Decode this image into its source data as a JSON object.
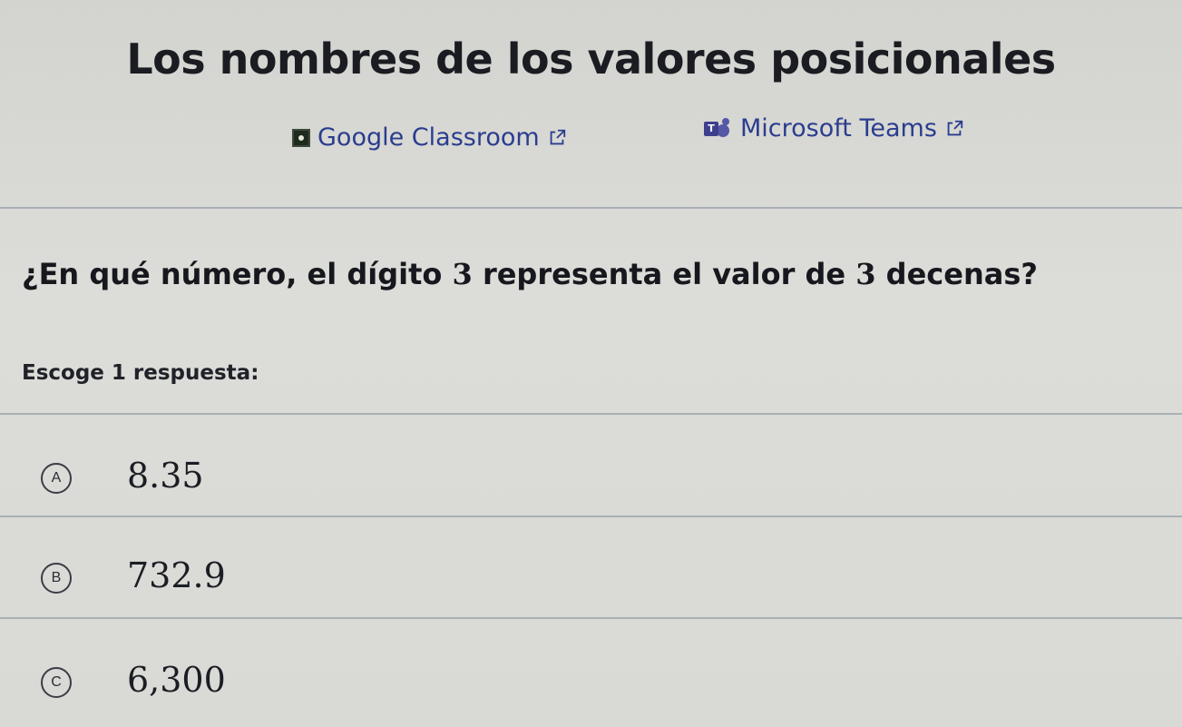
{
  "page": {
    "title": "Los nombres de los valores posicionales"
  },
  "share": {
    "google_classroom": {
      "label": "Google Classroom",
      "icon": "google-classroom-icon",
      "external_icon": "external-link-icon"
    },
    "microsoft_teams": {
      "label": "Microsoft Teams",
      "icon": "microsoft-teams-icon",
      "external_icon": "external-link-icon"
    }
  },
  "question": {
    "prefix": "¿En qué número, el dígito ",
    "digit": "3",
    "middle": " representa el valor de ",
    "count": "3",
    "suffix": " decenas?"
  },
  "instruction": "Escoge 1 respuesta:",
  "choices": [
    {
      "letter": "A",
      "value": "8.35"
    },
    {
      "letter": "B",
      "value": "732.9"
    },
    {
      "letter": "C",
      "value": "6,300"
    }
  ],
  "colors": {
    "link": "#2b3d8f",
    "text": "#1b1d24",
    "divider": "#a9b0b6",
    "background": "#d7d8d3"
  }
}
